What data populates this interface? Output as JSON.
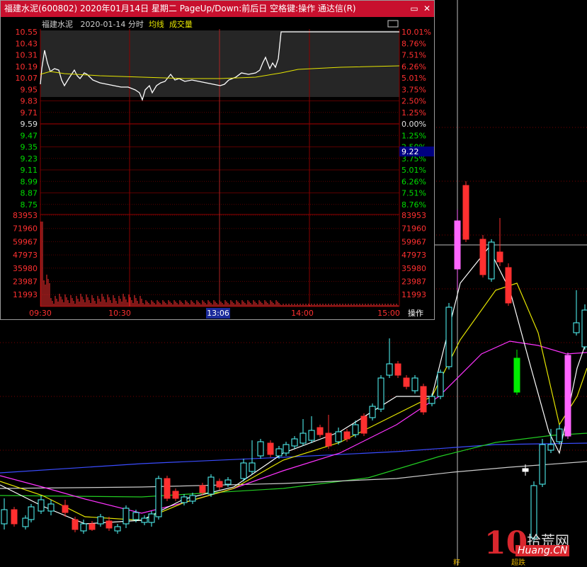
{
  "window": {
    "title": "福建水泥(600802) 2020年01月14日 星期二 PageUp/Down:前后日 空格键:操作 通达信(R)",
    "min_icon": "minimize-icon",
    "close_icon": "close-icon"
  },
  "subtitle": {
    "stock": "福建水泥",
    "date": "2020-01-14 分时",
    "avg_label": "均线",
    "vol_label": "成交量"
  },
  "price_axis": [
    "10.55",
    "10.43",
    "10.31",
    "10.19",
    "10.07",
    "9.95",
    "9.83",
    "9.71",
    "9.59",
    "9.47",
    "9.35",
    "9.23",
    "9.11",
    "8.99",
    "8.87",
    "8.75"
  ],
  "pct_axis": [
    "10.01%",
    "8.76%",
    "7.51%",
    "6.26%",
    "5.01%",
    "3.75%",
    "2.50%",
    "1.25%",
    "0.00%",
    "1.25%",
    "2.50%",
    "3.75%",
    "5.01%",
    "6.26%",
    "7.51%",
    "8.76%"
  ],
  "vol_axis": [
    "83953",
    "71960",
    "59967",
    "47973",
    "35980",
    "23987",
    "11993"
  ],
  "time_axis": [
    "09:30",
    "10:30",
    "13:06",
    "14:00",
    "15:00"
  ],
  "cursor_time": "13:06",
  "cursor_price": "9.22",
  "op_label": "操作",
  "bottom_labels": {
    "left": "籽",
    "right": "超跌"
  },
  "watermark": {
    "ten": "10",
    "cn": "拾荒网",
    "en": "Huang.CN"
  },
  "colors": {
    "title_bg": "#c8102e",
    "up": "#ff3030",
    "down": "#54ffff",
    "axis_red": "#ff3030",
    "axis_green": "#00dd00",
    "avg_line": "#e6e600",
    "grid": "#5a0000"
  }
}
